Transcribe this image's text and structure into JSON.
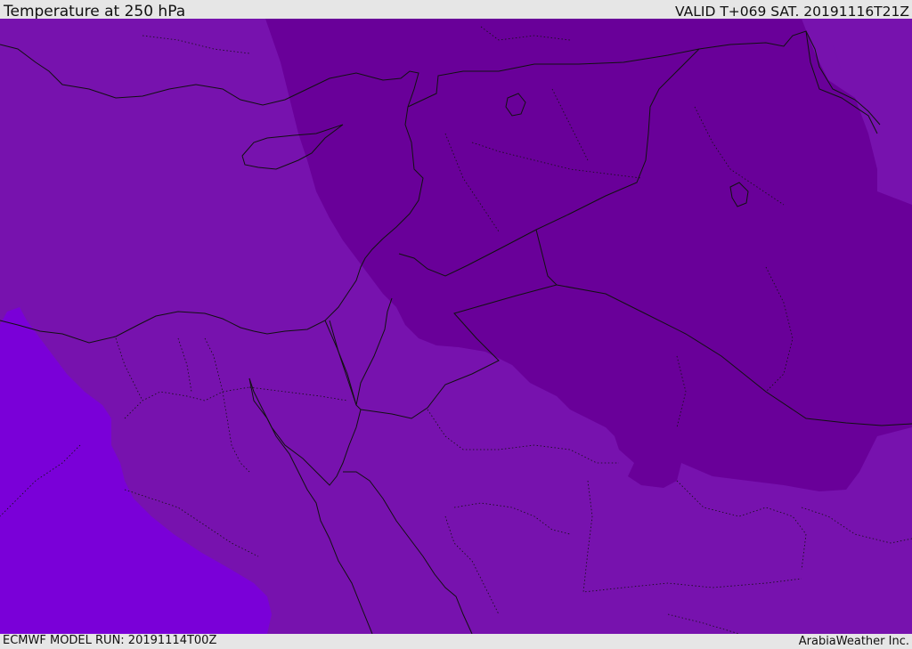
{
  "header": {
    "title": "Temperature at 250 hPa",
    "valid": "VALID T+069 SAT. 20191116T21Z"
  },
  "footer": {
    "model_run": "ECMWF MODEL RUN: 20191114T00Z",
    "credit": "ArabiaWeather Inc."
  },
  "map": {
    "fill_colors": {
      "coldest": "#7a00d8",
      "cold": "#7712ae",
      "warm": "#690099",
      "lines": "#111111"
    }
  }
}
